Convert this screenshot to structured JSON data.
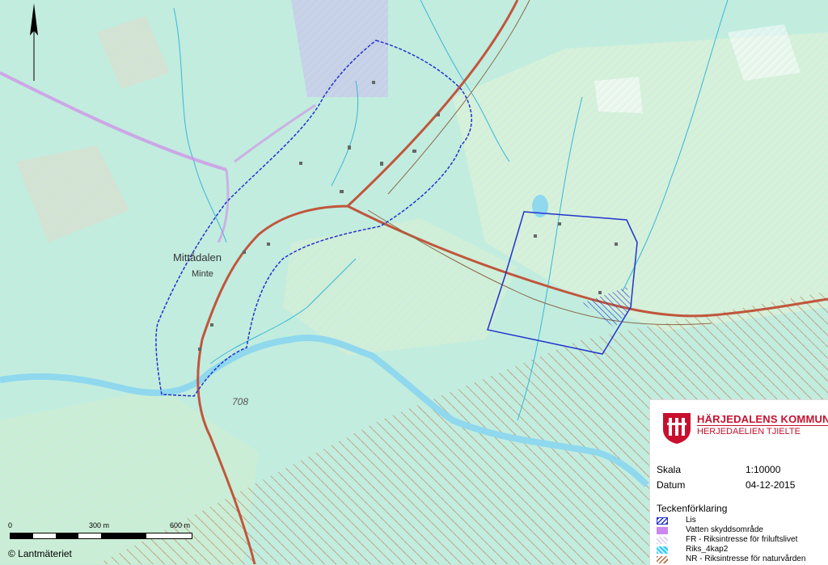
{
  "map": {
    "place_name": "Mittådalen",
    "place_name_sami": "Minte",
    "road_number": "708"
  },
  "scalebar": {
    "labels": [
      "0",
      "300 m",
      "600 m"
    ]
  },
  "copyright": "© Lantmäteriet",
  "legend": {
    "org_name": "HÄRJEDALENS KOMMUN",
    "org_subtitle": "HERJEDAELIEN TJIELTE",
    "scale_label": "Skala",
    "scale_value": "1:10000",
    "date_label": "Datum",
    "date_value": "04-12-2015",
    "title": "Teckenförklaring",
    "items": [
      {
        "label": "Lis",
        "color": "#2233cc"
      },
      {
        "label": "Vatten skyddsområde",
        "color": "#cc88ee"
      },
      {
        "label": "FR - Riksintresse för friluftslivet",
        "color": "#d8c8f0"
      },
      {
        "label": "Riks_4kap2",
        "color": "#33ccee"
      },
      {
        "label": "NR - Riksintresse för naturvården",
        "color": "#b06a3a"
      }
    ]
  },
  "colors": {
    "forest": "#bfeedd",
    "open_land": "#d3f2d8",
    "water": "#8fd8ee",
    "road": "#c0563c",
    "lis_boundary": "#2233cc"
  }
}
